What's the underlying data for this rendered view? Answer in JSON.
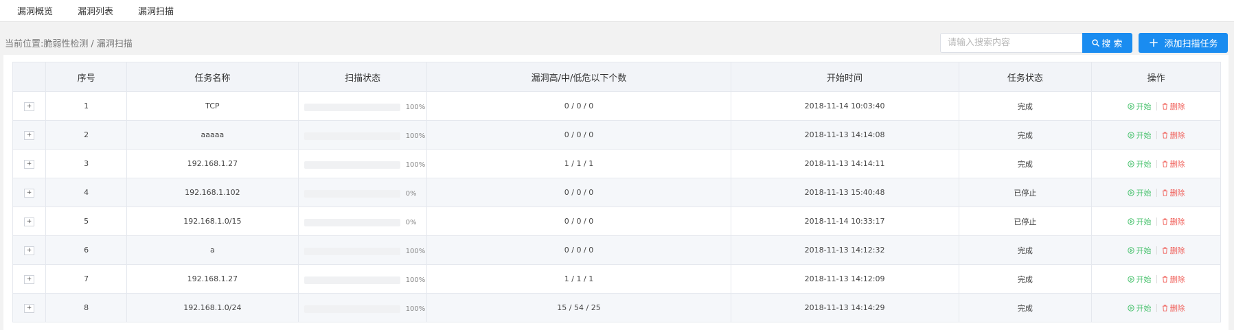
{
  "nav": {
    "tabs": [
      "漏洞概览",
      "漏洞列表",
      "漏洞扫描"
    ]
  },
  "breadcrumb": {
    "prefix": "当前位置:",
    "path": [
      "脆弱性检测",
      "漏洞扫描"
    ],
    "separator": "/"
  },
  "search": {
    "placeholder": "请输入搜索内容",
    "value": "",
    "button_label": "搜 索"
  },
  "add_button_label": "添加扫描任务",
  "colors": {
    "accent": "#1a8cf0",
    "start": "#49c26e",
    "delete": "#f0605a"
  },
  "table": {
    "columns": [
      "",
      "序号",
      "任务名称",
      "扫描状态",
      "漏洞高/中/低危以下个数",
      "开始时间",
      "任务状态",
      "操作"
    ],
    "expand_glyph": "+",
    "start_label": "开始",
    "delete_label": "删除",
    "rows": [
      {
        "index": "1",
        "name": "TCP",
        "progress": 100,
        "progress_label": "100%",
        "vulns": "0 / 0 / 0",
        "start_time": "2018-11-14 10:03:40",
        "status": "完成"
      },
      {
        "index": "2",
        "name": "aaaaa",
        "progress": 100,
        "progress_label": "100%",
        "vulns": "0 / 0 / 0",
        "start_time": "2018-11-13 14:14:08",
        "status": "完成"
      },
      {
        "index": "3",
        "name": "192.168.1.27",
        "progress": 100,
        "progress_label": "100%",
        "vulns": "1 / 1 / 1",
        "start_time": "2018-11-13 14:14:11",
        "status": "完成"
      },
      {
        "index": "4",
        "name": "192.168.1.102",
        "progress": 0,
        "progress_label": "0%",
        "vulns": "0 / 0 / 0",
        "start_time": "2018-11-13 15:40:48",
        "status": "已停止"
      },
      {
        "index": "5",
        "name": "192.168.1.0/15",
        "progress": 0,
        "progress_label": "0%",
        "vulns": "0 / 0 / 0",
        "start_time": "2018-11-14 10:33:17",
        "status": "已停止"
      },
      {
        "index": "6",
        "name": "a",
        "progress": 100,
        "progress_label": "100%",
        "vulns": "0 / 0 / 0",
        "start_time": "2018-11-13 14:12:32",
        "status": "完成"
      },
      {
        "index": "7",
        "name": "192.168.1.27",
        "progress": 100,
        "progress_label": "100%",
        "vulns": "1 / 1 / 1",
        "start_time": "2018-11-13 14:12:09",
        "status": "完成"
      },
      {
        "index": "8",
        "name": "192.168.1.0/24",
        "progress": 100,
        "progress_label": "100%",
        "vulns": "15 / 54 / 25",
        "start_time": "2018-11-13 14:14:29",
        "status": "完成"
      }
    ]
  }
}
